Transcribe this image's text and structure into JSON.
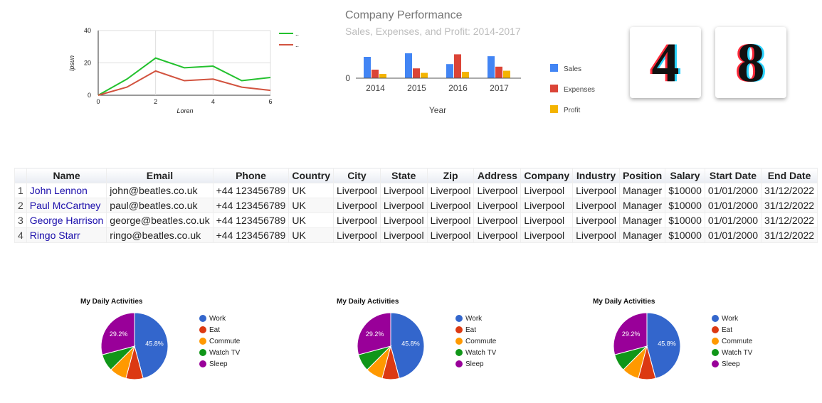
{
  "line_chart": {
    "xlabel": "Loren",
    "ylabel": "Ipsun",
    "legend": [
      "..",
      ".."
    ],
    "chart_data": {
      "type": "line",
      "x": [
        0,
        1,
        2,
        3,
        4,
        5,
        6
      ],
      "xticks": [
        "0",
        "2",
        "4",
        "6"
      ],
      "yticks": [
        "0",
        "20",
        "40"
      ],
      "xlim": [
        0,
        6
      ],
      "ylim": [
        0,
        40
      ],
      "series": [
        {
          "values": [
            0,
            10,
            23,
            17,
            18,
            9,
            11
          ],
          "color": "#23c12e"
        },
        {
          "values": [
            0,
            5,
            15,
            9,
            10,
            5,
            3
          ],
          "color": "#d2533f"
        }
      ]
    }
  },
  "bar_chart": {
    "title": "Company Performance",
    "subtitle": "Sales, Expenses, and Profit: 2014-2017",
    "xlabel": "Year",
    "zero_label": "0",
    "chart_data": {
      "type": "bar",
      "categories": [
        "2014",
        "2015",
        "2016",
        "2017"
      ],
      "series": [
        {
          "name": "Sales",
          "values": [
            1000,
            1170,
            660,
            1030
          ],
          "color": "#4285f4"
        },
        {
          "name": "Expenses",
          "values": [
            400,
            460,
            1120,
            540
          ],
          "color": "#db4437"
        },
        {
          "name": "Profit",
          "values": [
            200,
            250,
            300,
            350
          ],
          "color": "#f4b400"
        }
      ],
      "ylim": [
        0,
        1200
      ]
    }
  },
  "counters": {
    "d1": "4",
    "d2": "8"
  },
  "table": {
    "columns": [
      "Name",
      "Email",
      "Phone",
      "Country",
      "City",
      "State",
      "Zip",
      "Address",
      "Company",
      "Industry",
      "Position",
      "Salary",
      "Start Date",
      "End Date"
    ],
    "rows": [
      {
        "num": "1",
        "cells": [
          "John Lennon",
          "john@beatles.co.uk",
          "+44 123456789",
          "UK",
          "Liverpool",
          "Liverpool",
          "Liverpool",
          "Liverpool",
          "Liverpool",
          "Liverpool",
          "Manager",
          "$10000",
          "01/01/2000",
          "31/12/2022"
        ]
      },
      {
        "num": "2",
        "cells": [
          "Paul McCartney",
          "paul@beatles.co.uk",
          "+44 123456789",
          "UK",
          "Liverpool",
          "Liverpool",
          "Liverpool",
          "Liverpool",
          "Liverpool",
          "Liverpool",
          "Manager",
          "$10000",
          "01/01/2000",
          "31/12/2022"
        ]
      },
      {
        "num": "3",
        "cells": [
          "George Harrison",
          "george@beatles.co.uk",
          "+44 123456789",
          "UK",
          "Liverpool",
          "Liverpool",
          "Liverpool",
          "Liverpool",
          "Liverpool",
          "Liverpool",
          "Manager",
          "$10000",
          "01/01/2000",
          "31/12/2022"
        ]
      },
      {
        "num": "4",
        "cells": [
          "Ringo Starr",
          "ringo@beatles.co.uk",
          "+44 123456789",
          "UK",
          "Liverpool",
          "Liverpool",
          "Liverpool",
          "Liverpool",
          "Liverpool",
          "Liverpool",
          "Manager",
          "$10000",
          "01/01/2000",
          "31/12/2022"
        ]
      }
    ]
  },
  "pie": {
    "title": "My Daily Activities",
    "chart_data": {
      "type": "pie",
      "labels": [
        "Work",
        "Eat",
        "Commute",
        "Watch TV",
        "Sleep"
      ],
      "values": [
        11,
        2,
        2,
        2,
        7
      ],
      "colors": [
        "#3366cc",
        "#dc3912",
        "#ff9900",
        "#109618",
        "#990099"
      ],
      "slice_labels": [
        "45.8%",
        "",
        "",
        "",
        "29.2%"
      ]
    }
  }
}
